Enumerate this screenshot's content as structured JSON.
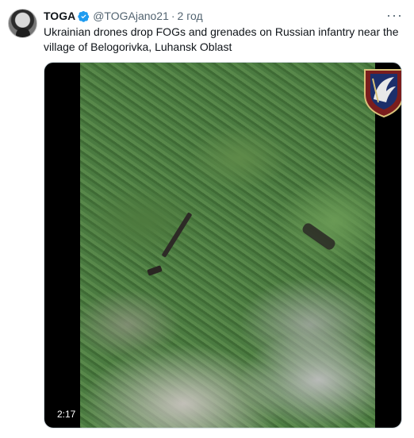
{
  "tweet": {
    "author_name": "TOGA",
    "handle": "@TOGAjano21",
    "separator": "·",
    "time": "2 год",
    "more_label": "···",
    "text": "Ukrainian drones drop FOGs and grenades on Russian infantry near the village of Belogorivka, Luhansk Oblast"
  },
  "media": {
    "duration": "2:17"
  },
  "icons": {
    "verified": "verified-badge-icon",
    "more": "more-options-icon",
    "emblem": "unit-emblem-icon"
  },
  "colors": {
    "accent": "#1d9bf0",
    "secondary_text": "#536471",
    "primary_text": "#0f1419"
  }
}
